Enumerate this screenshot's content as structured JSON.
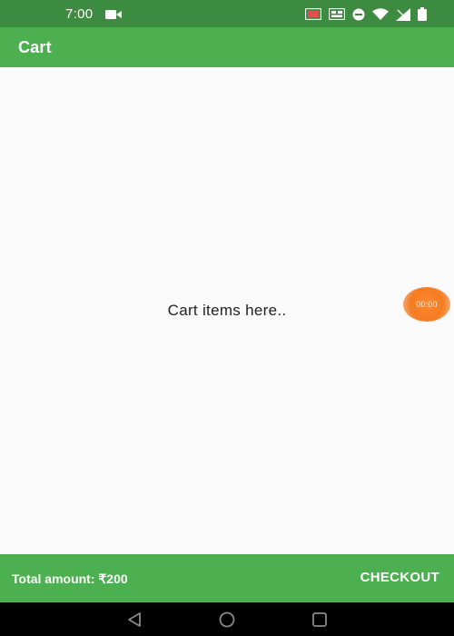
{
  "status_bar": {
    "time": "7:00",
    "icons": [
      "video-camera-icon",
      "sim-card-icon",
      "volte-icon",
      "do-not-disturb-icon",
      "wifi-icon",
      "signal-icon",
      "battery-icon"
    ]
  },
  "app_bar": {
    "title": "Cart"
  },
  "content": {
    "empty_message": "Cart items here.."
  },
  "floating_timer": {
    "label": "00:00"
  },
  "bottom_bar": {
    "total_label": "Total amount: ₹200",
    "checkout_label": "CHECKOUT"
  },
  "nav_bar": {
    "icons": [
      "back-icon",
      "home-icon",
      "recents-icon"
    ]
  },
  "colors": {
    "status_bar": "#3d8b40",
    "primary": "#4caf50",
    "background": "#fafafa",
    "timer": "#f47b20",
    "nav_bar": "#000000"
  }
}
